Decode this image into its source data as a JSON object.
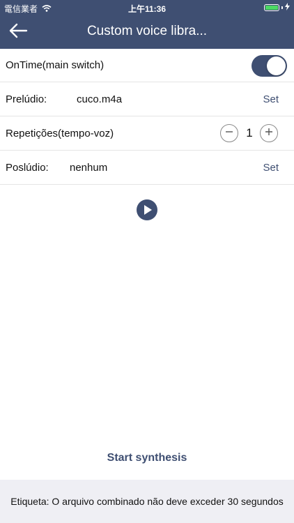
{
  "status_bar": {
    "carrier": "電信業者",
    "time": "上午11:36",
    "wifi_icon": "wifi-icon",
    "battery_icon": "battery-icon",
    "battery_level": 1.0,
    "battery_color": "#4cd964"
  },
  "nav": {
    "title": "Custom voice libra...",
    "back_icon": "arrow-left-icon",
    "background": "#3f4f72"
  },
  "main_switch": {
    "label": "OnTime(main switch)",
    "on": true
  },
  "prelude": {
    "label": "Prelúdio:",
    "value": "cuco.m4a",
    "action": "Set"
  },
  "repetitions": {
    "label": "Repetições(tempo-voz)",
    "value": "1",
    "minus_icon": "minus-icon",
    "plus_icon": "plus-icon"
  },
  "postlude": {
    "label": "Poslúdio:",
    "value": "nenhum",
    "action": "Set"
  },
  "play": {
    "icon": "play-icon"
  },
  "start_button": {
    "label": "Start synthesis"
  },
  "footer": {
    "note": "Etiqueta: O arquivo combinado não deve exceder 30 segundos"
  }
}
